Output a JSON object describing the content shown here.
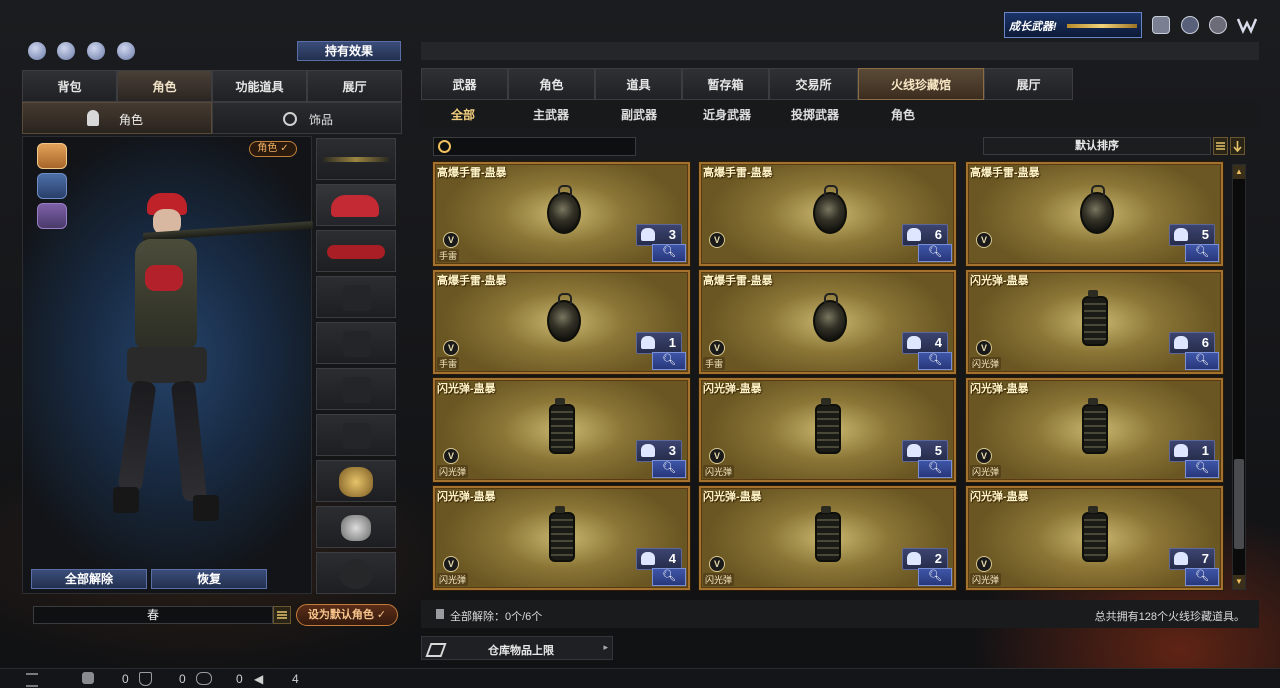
{
  "top_banner": {
    "label": "成长武器!"
  },
  "left_panel": {
    "effect_button": "持有效果",
    "tabs": [
      "背包",
      "角色",
      "功能道具",
      "展厅"
    ],
    "active_tab": 1,
    "subtabs": [
      {
        "label": "角色",
        "icon": "character-icon"
      },
      {
        "label": "饰品",
        "icon": "ring-icon"
      }
    ],
    "role_tag": "角色",
    "unequip_all_button": "全部解除",
    "restore_button": "恢复",
    "name_field": "春",
    "set_default_button": "设为默认角色"
  },
  "right_panel": {
    "tabs": [
      "武器",
      "角色",
      "道具",
      "暂存箱",
      "交易所",
      "火线珍藏馆",
      "展厅"
    ],
    "active_tab": 5,
    "subtabs": [
      "全部",
      "主武器",
      "副武器",
      "近身武器",
      "投掷武器",
      "角色"
    ],
    "active_subtab": 0,
    "search": {
      "value": "",
      "placeholder": ""
    },
    "sort_label": "默认排序",
    "items": [
      {
        "title": "高爆手雷-蛊暴",
        "sub": "手雷",
        "count": "3",
        "kind": "grenade"
      },
      {
        "title": "高爆手雷-蛊暴",
        "sub": "",
        "count": "6",
        "kind": "grenade"
      },
      {
        "title": "高爆手雷-蛊暴",
        "sub": "",
        "count": "5",
        "kind": "grenade"
      },
      {
        "title": "高爆手雷-蛊暴",
        "sub": "手雷",
        "count": "1",
        "kind": "grenade"
      },
      {
        "title": "高爆手雷-蛊暴",
        "sub": "手雷",
        "count": "4",
        "kind": "grenade"
      },
      {
        "title": "闪光弹-蛊暴",
        "sub": "闪光弹",
        "count": "6",
        "kind": "flash"
      },
      {
        "title": "闪光弹-蛊暴",
        "sub": "闪光弹",
        "count": "3",
        "kind": "flash"
      },
      {
        "title": "闪光弹-蛊暴",
        "sub": "闪光弹",
        "count": "5",
        "kind": "flash"
      },
      {
        "title": "闪光弹-蛊暴",
        "sub": "闪光弹",
        "count": "1",
        "kind": "flash"
      },
      {
        "title": "闪光弹-蛊暴",
        "sub": "闪光弹",
        "count": "4",
        "kind": "flash"
      },
      {
        "title": "闪光弹-蛊暴",
        "sub": "闪光弹",
        "count": "2",
        "kind": "flash"
      },
      {
        "title": "闪光弹-蛊暴",
        "sub": "闪光弹",
        "count": "7",
        "kind": "flash"
      }
    ],
    "footer_unequip": "全部解除：0个/6个",
    "footer_total": "总共拥有128个火线珍藏道具。",
    "storage_limit": "仓库物品上限"
  },
  "status_bar": {
    "values": [
      "0",
      "0",
      "0",
      "4"
    ]
  },
  "colors": {
    "gold_border": "#a3722f",
    "accent_gold": "#f2cf7e",
    "blue_button": "#3b4d7a"
  }
}
